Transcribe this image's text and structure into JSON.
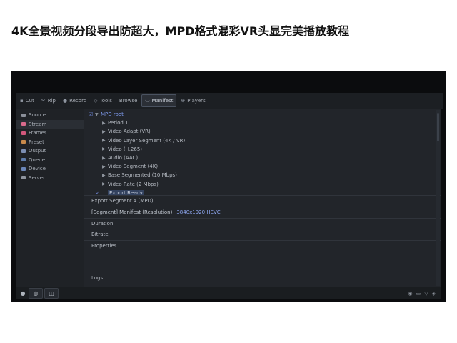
{
  "headline": "4K全景视频分段导出防超大，MPD格式混彩VR头显完美播放教程",
  "toolbar": {
    "items": [
      {
        "label": "Cut",
        "icon": "▪",
        "active": false
      },
      {
        "label": "Rip",
        "icon": "✂",
        "active": false
      },
      {
        "label": "Record",
        "icon": "●",
        "active": false
      },
      {
        "label": "Tools",
        "icon": "◇",
        "active": false
      },
      {
        "label": "Browse",
        "icon": "",
        "active": false
      },
      {
        "label": "Manifest",
        "icon": "⎔",
        "active": true
      },
      {
        "label": "Players",
        "icon": "⊕",
        "active": false
      }
    ]
  },
  "sidebar": {
    "items": [
      {
        "label": "Source",
        "color": "#8a8f99"
      },
      {
        "label": "Stream",
        "color": "#d96a8c"
      },
      {
        "label": "Frames",
        "color": "#d2577c"
      },
      {
        "label": "Preset",
        "color": "#c98a4b"
      },
      {
        "label": "Output",
        "color": "#7c8fb3"
      },
      {
        "label": "Queue",
        "color": "#5c7aa8"
      },
      {
        "label": "Device",
        "color": "#6a86b8"
      },
      {
        "label": "Server",
        "color": "#8e949e"
      }
    ]
  },
  "tree": {
    "nodes": [
      {
        "text": "MPD root",
        "arrow": "▼",
        "check": "☑",
        "sel": false,
        "indent": 0
      },
      {
        "text": "Period 1",
        "arrow": "▶",
        "check": "",
        "sel": false,
        "indent": 1
      },
      {
        "text": "Video Adapt (VR)",
        "arrow": "▶",
        "check": "",
        "sel": false,
        "indent": 1
      },
      {
        "text": "Video Layer Segment (4K / VR)",
        "arrow": "▶",
        "check": "",
        "sel": false,
        "indent": 1
      },
      {
        "text": "Video (H.265)",
        "arrow": "▶",
        "check": "",
        "sel": false,
        "indent": 1
      },
      {
        "text": "Audio (AAC)",
        "arrow": "▶",
        "check": "",
        "sel": false,
        "indent": 1
      },
      {
        "text": "Video Segment (4K)",
        "arrow": "▶",
        "check": "",
        "sel": false,
        "indent": 1
      },
      {
        "text": "Base Segmented (10 Mbps)",
        "arrow": "▶",
        "check": "",
        "sel": false,
        "indent": 1
      },
      {
        "text": "Video Rate (2 Mbps)",
        "arrow": "▶",
        "check": "",
        "sel": false,
        "indent": 1
      },
      {
        "text": "Export Ready",
        "arrow": "",
        "check": "✓",
        "sel": true,
        "indent": 1
      }
    ]
  },
  "rows": {
    "summary": "Export Segment 4 (MPD)",
    "url_left": "[Segment] Manifest (Resolution)",
    "url_right": "3840x1920 HEVC",
    "r1": "Duration",
    "r2": "Bitrate",
    "r3": "Properties",
    "footer": "Logs"
  },
  "bottom": {
    "buttons": [
      {
        "icon": "●",
        "boxed": false
      },
      {
        "icon": "◍",
        "boxed": true
      },
      {
        "icon": "◫",
        "boxed": true
      }
    ],
    "right_icons": [
      "◉",
      "▭",
      "▽",
      "◈"
    ]
  }
}
